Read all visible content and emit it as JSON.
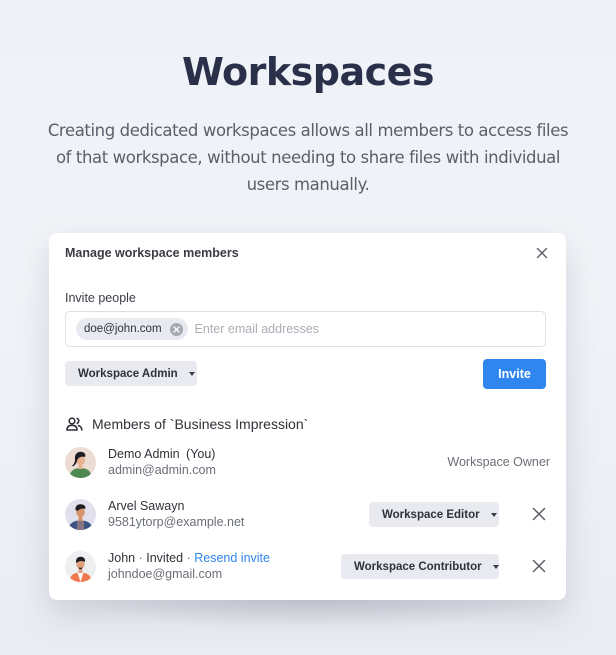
{
  "hero": {
    "title": "Workspaces",
    "description": "Creating dedicated workspaces allows all members to access files of that workspace, without needing to share files with individual users manually."
  },
  "modal": {
    "title": "Manage workspace members",
    "close_icon": "close-icon",
    "invite_label": "Invite people",
    "chips": [
      {
        "email": "doe@john.com"
      }
    ],
    "email_placeholder": "Enter email addresses",
    "role_select": "Workspace Admin",
    "invite_button": "Invite",
    "members_heading": "Members of `Business Impression`",
    "members_icon": "users-icon",
    "members": [
      {
        "name": "Demo Admin",
        "suffix": "(You)",
        "email": "admin@admin.com",
        "role": "Workspace Owner",
        "role_editable": false
      },
      {
        "name": "Arvel Sawayn",
        "email": "9581ytorp@example.net",
        "role": "Workspace Editor",
        "role_editable": true
      },
      {
        "name": "John",
        "status": "Invited",
        "action": "Resend invite",
        "separator": "·",
        "email": "johndoe@gmail.com",
        "role": "Workspace Contributor",
        "role_editable": true
      }
    ]
  },
  "colors": {
    "accent": "#2f86ee",
    "title": "#2a3049",
    "chip_bg": "#e8eaef"
  }
}
